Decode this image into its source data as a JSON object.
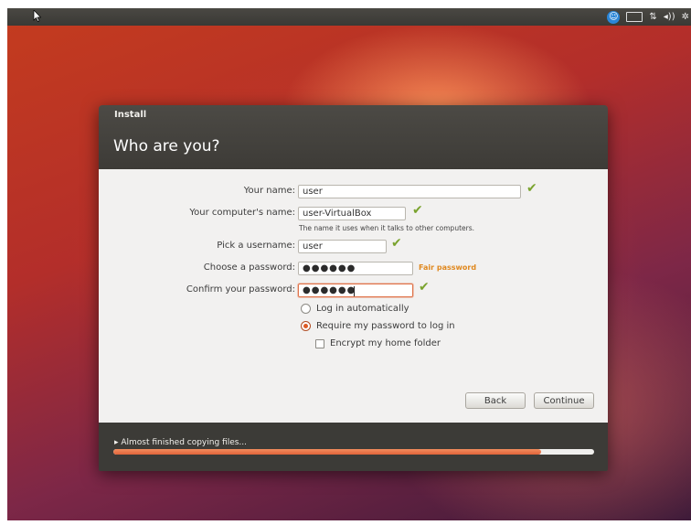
{
  "topbar": {
    "icons": [
      "cursor-icon",
      "accessibility-icon",
      "keyboard-icon",
      "network-icon",
      "volume-icon",
      "gear-icon"
    ]
  },
  "dialog": {
    "window_title": "Install",
    "heading": "Who are you?",
    "form": {
      "your_name_label": "Your name:",
      "your_name_value": "user",
      "computer_name_label": "Your computer's name:",
      "computer_name_value": "user-VirtualBox",
      "computer_name_hint": "The name it uses when it talks to other computers.",
      "username_label": "Pick a username:",
      "username_value": "user",
      "password_label": "Choose a password:",
      "password_mask": "●●●●●●",
      "password_strength": "Fair password",
      "confirm_label": "Confirm your password:",
      "confirm_mask": "●●●●●●"
    },
    "options": {
      "login_auto": "Log in automatically",
      "login_require": "Require my password to log in",
      "encrypt_home": "Encrypt my home folder",
      "selected": "login_require",
      "encrypt_checked": false
    },
    "buttons": {
      "back": "Back",
      "continue": "Continue"
    },
    "footer": {
      "status": "▸ Almost finished copying files...",
      "progress_fraction": 0.89
    }
  },
  "colors": {
    "accent": "#dd5a24",
    "check": "#7aa32e",
    "strength": "#e0881e",
    "header": "#3c3b37",
    "body": "#f2f1f0"
  }
}
